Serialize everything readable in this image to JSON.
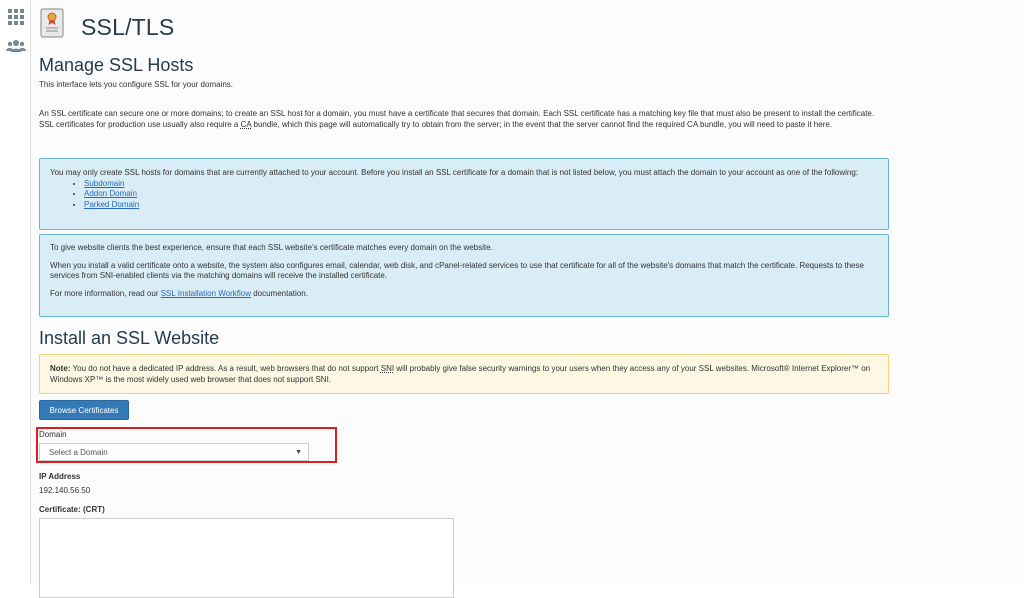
{
  "sidebar": {
    "items": [
      {
        "icon": "grid-icon"
      },
      {
        "icon": "users-icon"
      }
    ]
  },
  "header": {
    "title": "SSL/TLS",
    "icon": "ssl-certificate-icon"
  },
  "manage": {
    "title": "Manage SSL Hosts",
    "subtitle": "This interface lets you configure SSL for your domains.",
    "description_pre": "An SSL certificate can secure one or more domains; to create an SSL host for a domain, you must have a certificate that secures that domain. Each SSL certificate has a matching key file that must also be present to install the certificate. SSL certificates for production use usually also require a ",
    "description_abbr": "CA",
    "description_post": " bundle, which this page will automatically try to obtain from the server; in the event that the server cannot find the required CA bundle, you will need to paste it here."
  },
  "info_box1": {
    "text": "You may only create SSL hosts for domains that are currently attached to your account. Before you install an SSL certificate for a domain that is not listed below, you must attach the domain to your account as one of the following:",
    "links": [
      "Subdomain",
      "Addon Domain",
      "Parked Domain"
    ]
  },
  "info_box2": {
    "para1": "To give website clients the best experience, ensure that each SSL website's certificate matches every domain on the website.",
    "para2": "When you install a valid certificate onto a website, the system also configures email, calendar, web disk, and cPanel-related services to use that certificate for all of the website's domains that match the certificate. Requests to these services from SNI-enabled clients via the matching domains will receive the installed certificate.",
    "para3_pre": "For more information, read our ",
    "para3_link": "SSL Installation Workflow",
    "para3_post": " documentation."
  },
  "install": {
    "title": "Install an SSL Website",
    "note_label": "Note:",
    "note_pre": " You do not have a dedicated IP address. As a result, web browsers that do not support ",
    "note_abbr": "SNI",
    "note_post": " will probably give false security warnings to your users when they access any of your SSL websites. Microsoft® Internet Explorer™ on Windows XP™ is the most widely used web browser that does not support SNI.",
    "browse_button": "Browse Certificates",
    "domain_label": "Domain",
    "domain_placeholder": "Select a Domain",
    "ip_label": "IP Address",
    "ip_value": "192.140.56.50",
    "certificate_label": "Certificate: (CRT)"
  },
  "colors": {
    "accent": "#337ab7",
    "highlight": "#e01b22",
    "info_bg": "#d9edf7",
    "warning_bg": "#fcf8e3"
  }
}
